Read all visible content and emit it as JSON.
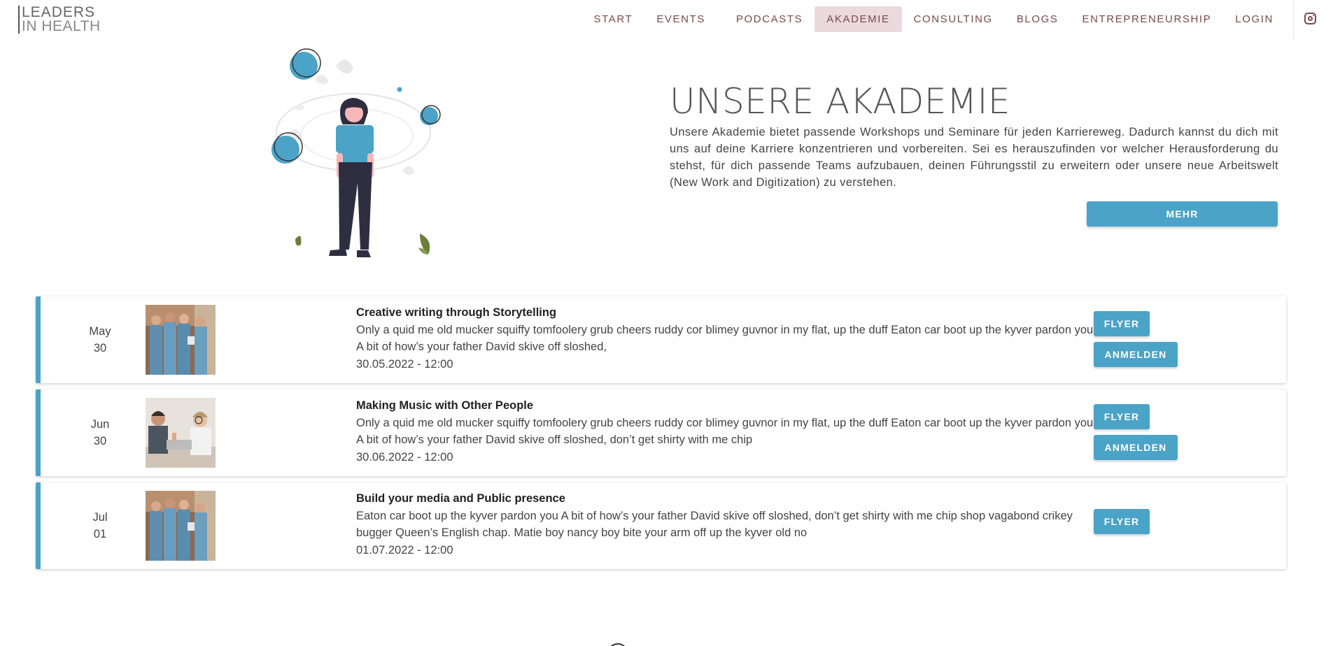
{
  "header": {
    "logo_line1": "LEADERS",
    "logo_line2": "IN HEALTH",
    "nav": [
      {
        "label": "START",
        "active": false
      },
      {
        "label": "EVENTS",
        "active": false
      },
      {
        "label": "PODCASTS",
        "active": false
      },
      {
        "label": "AKADEMIE",
        "active": true
      },
      {
        "label": "CONSULTING",
        "active": false
      },
      {
        "label": "BLOGS",
        "active": false
      },
      {
        "label": "ENTREPRENEURSHIP",
        "active": false
      },
      {
        "label": "LOGIN",
        "active": false
      }
    ],
    "social_icon": "instagram-icon"
  },
  "hero": {
    "title": "UNSERE AKADEMIE",
    "description": "Unsere Akademie bietet passende Workshops und Seminare für jeden Karriereweg. Dadurch kannst du dich mit uns auf deine Karriere konzentrieren und vorbereiten. Sei es herauszufinden vor welcher Herausforderung du stehst, für dich passende Teams aufzubauen, deinen Führungsstil zu erweitern oder unsere neue Arbeitswelt (New Work and Digitization) zu verstehen.",
    "more_button": "MEHR"
  },
  "events": [
    {
      "month": "May",
      "day": "30",
      "title": "Creative writing through Storytelling",
      "description": "Only a quid me old mucker squiffy tomfoolery grub cheers ruddy cor blimey guvnor in my flat, up the duff Eaton car boot up the kyver pardon you A bit of how’s your father David skive off sloshed,",
      "datetime": "30.05.2022 - 12:00",
      "flyer_label": "FLYER",
      "register_label": "ANMELDEN"
    },
    {
      "month": "Jun",
      "day": "30",
      "title": "Making Music with Other People",
      "description": "Only a quid me old mucker squiffy tomfoolery grub cheers ruddy cor blimey guvnor in my flat, up the duff Eaton car boot up the kyver pardon you A bit of how’s your father David skive off sloshed, don’t get shirty with me chip",
      "datetime": "30.06.2022 - 12:00",
      "flyer_label": "FLYER",
      "register_label": "ANMELDEN"
    },
    {
      "month": "Jul",
      "day": "01",
      "title": "Build your media and Public presence",
      "description": "Eaton car boot up the kyver pardon you A bit of how’s your father David skive off sloshed, don’t get shirty with me chip shop vagabond crikey bugger Queen’s English chap. Matie boy nancy boy bite your arm off up the kyver old no",
      "datetime": "01.07.2022 - 12:00",
      "flyer_label": "FLYER"
    }
  ],
  "colors": {
    "accent": "#4ba3c7",
    "nav_text": "#7a4a4a",
    "nav_active_bg": "#ead9dd"
  }
}
